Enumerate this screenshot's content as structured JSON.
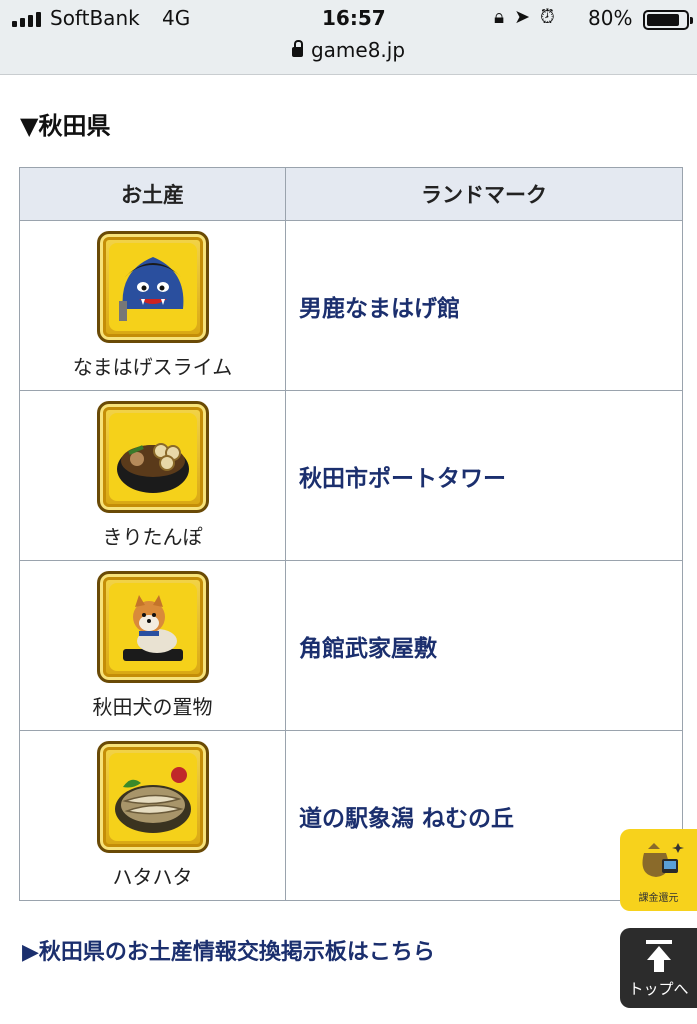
{
  "status_bar": {
    "carrier": "SoftBank",
    "network": "4G",
    "time": "16:57",
    "battery_percent": "80%",
    "battery_level": 0.8,
    "icons": [
      "orientation-lock-icon",
      "location-arrow-icon",
      "alarm-icon"
    ]
  },
  "browser": {
    "url": "game8.jp"
  },
  "section_title": "▼秋田県",
  "table": {
    "headers": [
      "お土産",
      "ランドマーク"
    ],
    "rows": [
      {
        "item": "なまはげスライム",
        "icon": "namahage-slime-icon",
        "landmark": "男鹿なまはげ館"
      },
      {
        "item": "きりたんぽ",
        "icon": "kiritanpo-hotpot-icon",
        "landmark": "秋田市ポートタワー"
      },
      {
        "item": "秋田犬の置物",
        "icon": "akita-dog-figurine-icon",
        "landmark": "角館武家屋敷"
      },
      {
        "item": "ハタハタ",
        "icon": "hatahata-fish-icon",
        "landmark": "道の駅象潟 ねむの丘"
      }
    ]
  },
  "bbs_link": "▶秋田県のお土産情報交換掲示板はこちら",
  "widgets": {
    "refund": "課金還元",
    "to_top": "トップへ"
  },
  "colors": {
    "link": "#1b2f6e",
    "header_bg": "#e4e9f1",
    "icon_gold": "#f5d11a",
    "refund_bg": "#f7d21c",
    "to_top_bg": "#2c2c2c"
  }
}
